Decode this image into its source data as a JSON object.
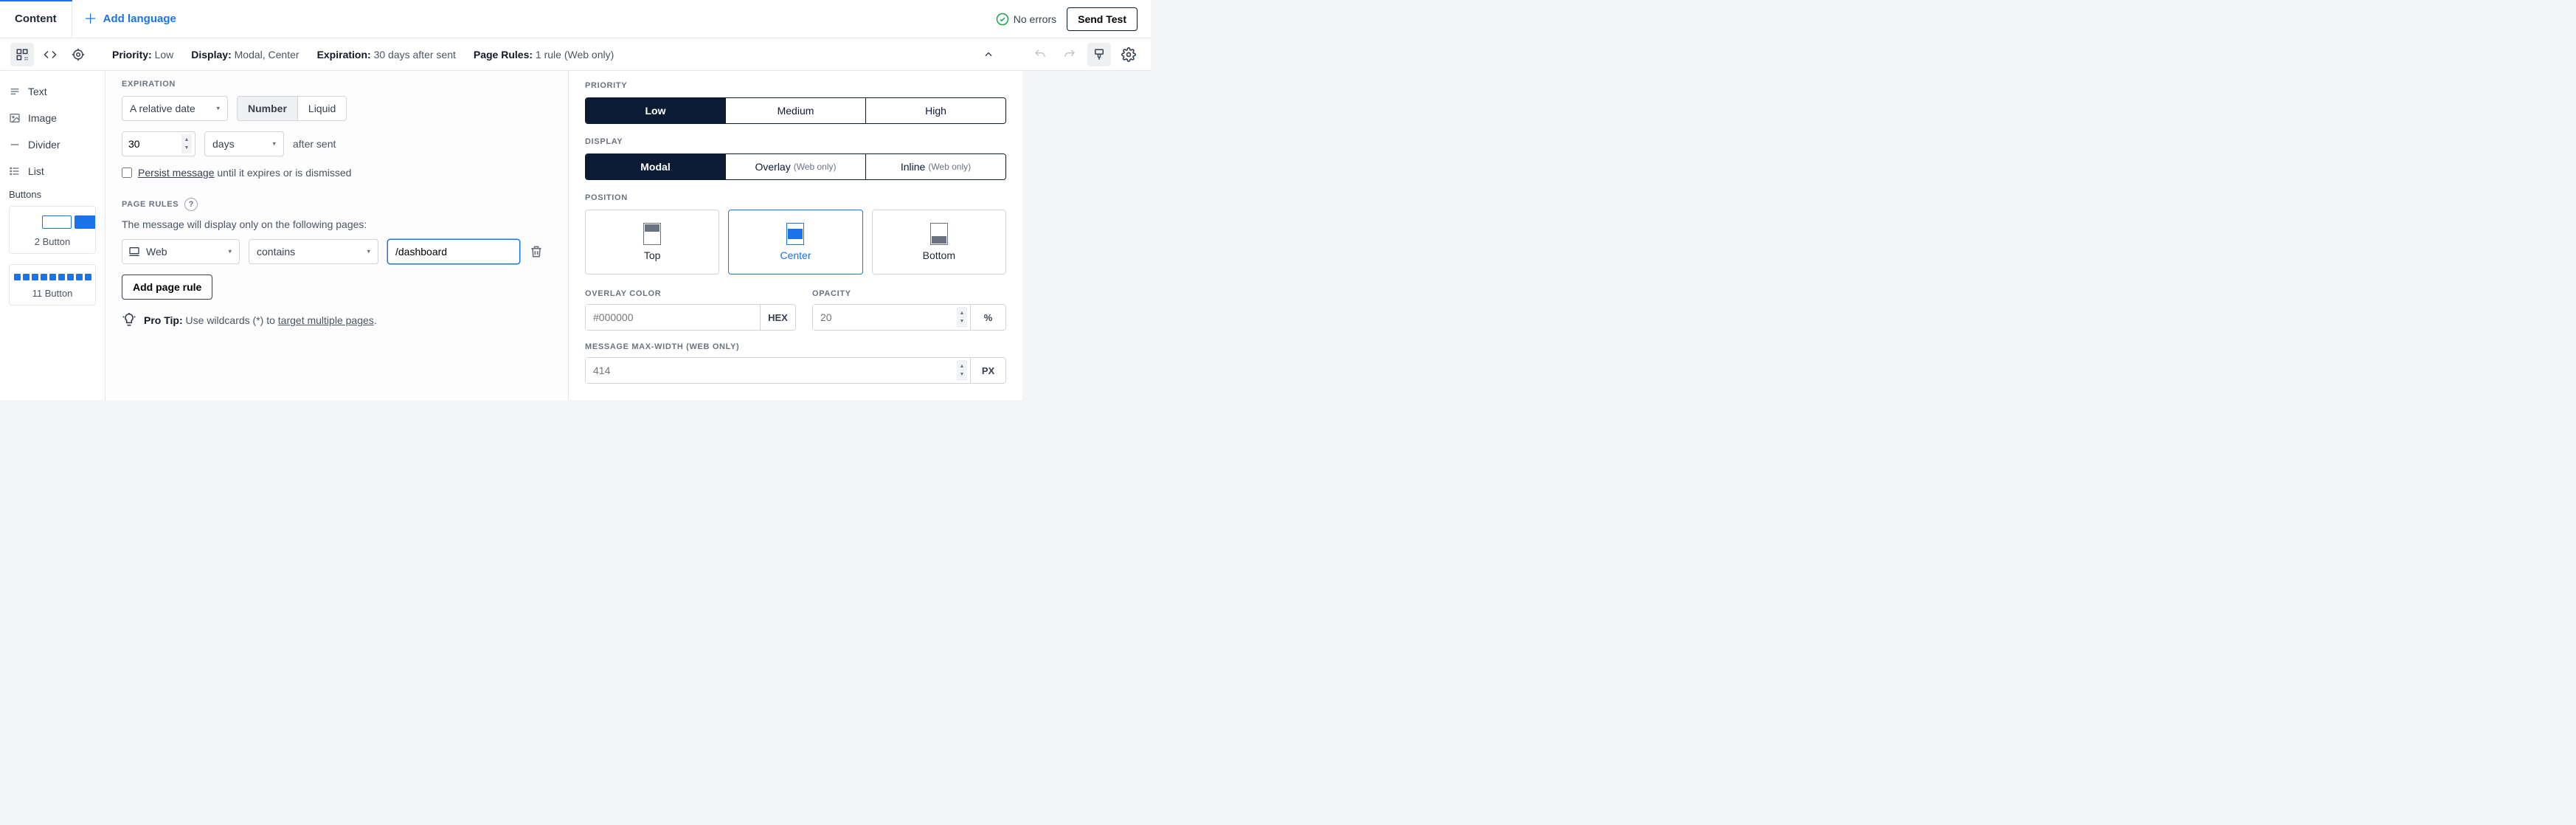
{
  "tabs": {
    "content": "Content",
    "add_language": "Add language"
  },
  "status": {
    "no_errors": "No errors",
    "send_test": "Send Test"
  },
  "summary": {
    "priority_label": "Priority:",
    "priority_value": "Low",
    "display_label": "Display:",
    "display_value": "Modal, Center",
    "expiration_label": "Expiration:",
    "expiration_value": "30 days after sent",
    "page_rules_label": "Page Rules:",
    "page_rules_value": "1 rule (Web only)"
  },
  "sidebar": {
    "items": [
      "Text",
      "Image",
      "Divider",
      "List"
    ],
    "buttons_label": "Buttons",
    "card2": "2 Button",
    "card11": "11 Button"
  },
  "expiration": {
    "label": "EXPIRATION",
    "date_type": "A relative date",
    "number": "Number",
    "liquid": "Liquid",
    "amount": "30",
    "unit": "days",
    "after_sent": "after sent",
    "persist_underline": "Persist message",
    "persist_rest": " until it expires or is dismissed"
  },
  "page_rules": {
    "label": "PAGE RULES",
    "desc": "The message will display only on the following pages:",
    "platform": "Web",
    "match": "contains",
    "path": "/dashboard",
    "add": "Add page rule",
    "tip_bold": "Pro Tip:",
    "tip_text": " Use wildcards (*) to ",
    "tip_link": "target multiple pages",
    "tip_end": "."
  },
  "right": {
    "priority_label": "PRIORITY",
    "priority": {
      "low": "Low",
      "medium": "Medium",
      "high": "High"
    },
    "display_label": "DISPLAY",
    "display": {
      "modal": "Modal",
      "overlay": "Overlay",
      "inline": "Inline",
      "web_only": "(Web only)"
    },
    "position_label": "POSITION",
    "position": {
      "top": "Top",
      "center": "Center",
      "bottom": "Bottom"
    },
    "overlay_color_label": "OVERLAY COLOR",
    "overlay_color_placeholder": "#000000",
    "hex": "HEX",
    "opacity_label": "OPACITY",
    "opacity_placeholder": "20",
    "percent": "%",
    "max_width_label": "MESSAGE MAX-WIDTH (WEB ONLY)",
    "max_width_placeholder": "414",
    "px": "PX"
  }
}
